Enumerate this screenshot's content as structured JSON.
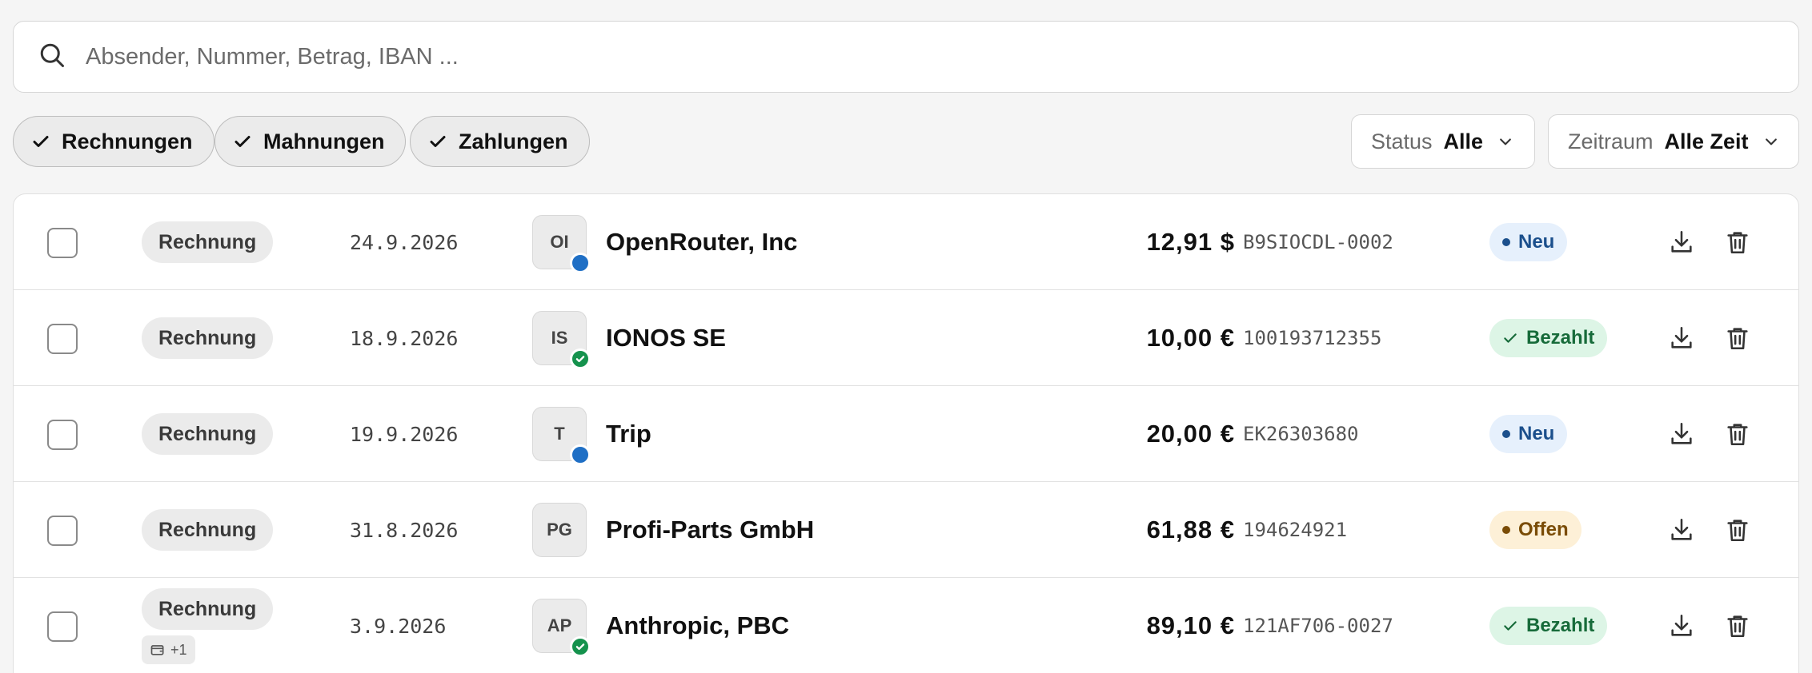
{
  "search": {
    "placeholder": "Absender, Nummer, Betrag, IBAN ...",
    "value": ""
  },
  "filters": {
    "chips": [
      {
        "label": "Rechnungen",
        "checked": true
      },
      {
        "label": "Mahnungen",
        "checked": true
      },
      {
        "label": "Zahlungen",
        "checked": true
      }
    ],
    "status": {
      "label": "Status",
      "value": "Alle"
    },
    "period": {
      "label": "Zeitraum",
      "value": "Alle Zeit"
    }
  },
  "colors": {
    "status_neu_bg": "#e6f0fc",
    "status_neu_text": "#1b4f8c",
    "status_bezahlt_bg": "#ddf5e6",
    "status_bezahlt_text": "#176b3a",
    "status_offen_bg": "#fdf0d7",
    "status_offen_text": "#7a4c06",
    "dot_blue": "#1f6fc5",
    "dot_green": "#15924d"
  },
  "rows": [
    {
      "type": "Rechnung",
      "date": "24.9.2026",
      "initials": "OI",
      "indicator": "blue",
      "name": "OpenRouter, Inc",
      "amount": "12,91 $",
      "reference": "B9SIOCDL-0002",
      "status": "Neu",
      "status_kind": "neu"
    },
    {
      "type": "Rechnung",
      "date": "18.9.2026",
      "initials": "IS",
      "indicator": "green-check",
      "name": "IONOS SE",
      "amount": "10,00 €",
      "reference": "100193712355",
      "status": "Bezahlt",
      "status_kind": "bezahlt"
    },
    {
      "type": "Rechnung",
      "date": "19.9.2026",
      "initials": "T",
      "indicator": "blue",
      "name": "Trip",
      "amount": "20,00 €",
      "reference": "EK26303680",
      "status": "Neu",
      "status_kind": "neu"
    },
    {
      "type": "Rechnung",
      "date": "31.8.2026",
      "initials": "PG",
      "indicator": "none",
      "name": "Profi-Parts GmbH",
      "amount": "61,88 €",
      "reference": "194624921",
      "status": "Offen",
      "status_kind": "offen"
    },
    {
      "type": "Rechnung",
      "extra_badge": "+1",
      "extra_icon": "wallet-icon",
      "date": "3.9.2026",
      "initials": "AP",
      "indicator": "green-check",
      "name": "Anthropic, PBC",
      "amount": "89,10 €",
      "reference": "121AF706-0027",
      "status": "Bezahlt",
      "status_kind": "bezahlt"
    }
  ],
  "icons": {
    "search": "search-icon",
    "check": "check-icon",
    "chevron": "chevron-down-icon",
    "download": "download-icon",
    "trash": "trash-icon"
  }
}
